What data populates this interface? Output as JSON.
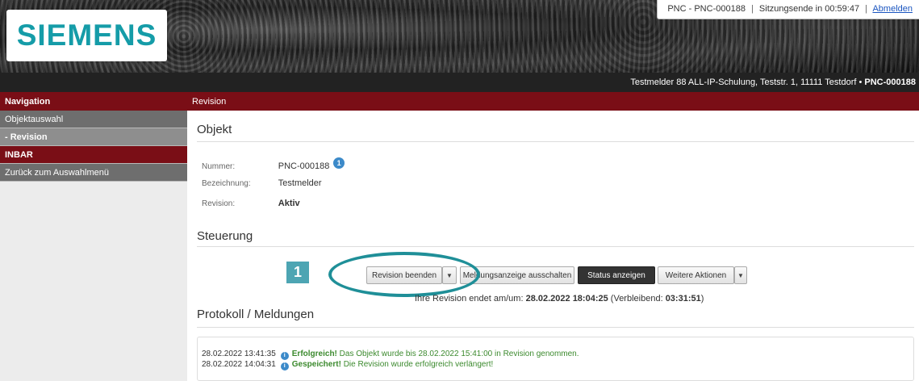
{
  "header": {
    "brand": "SIEMENS",
    "session": {
      "pnc": "PNC - PNC-000188",
      "separator": "|",
      "session_end": "Sitzungsende in 00:59:47",
      "logout": "Abmelden"
    },
    "subheader": {
      "location": "Testmelder 88 ALL-IP-Schulung, Teststr. 1, 11111 Testdorf",
      "bullet": "•",
      "id": "PNC-000188"
    }
  },
  "sidebar": {
    "title": "Navigation",
    "items": [
      {
        "label": "Objektauswahl"
      },
      {
        "label": "- Revision"
      },
      {
        "label": "INBAR"
      },
      {
        "label": "Zurück zum Auswahlmenü"
      }
    ]
  },
  "main": {
    "title": "Revision",
    "objekt": {
      "heading": "Objekt",
      "nummer_label": "Nummer:",
      "nummer_value": "PNC-000188",
      "nummer_badge": "1",
      "bezeichnung_label": "Bezeichnung:",
      "bezeichnung_value": "Testmelder",
      "revision_label": "Revision:",
      "revision_value": "Aktiv"
    },
    "steuerung": {
      "heading": "Steuerung",
      "marker": "1",
      "buttons": {
        "revision_beenden": "Revision beenden",
        "meldungsanzeige": "Meldungsanzeige ausschalten",
        "status_anzeigen": "Status anzeigen",
        "weitere_aktionen": "Weitere Aktionen"
      },
      "info_prefix": "Ihre Revision endet am/um:",
      "info_end": "28.02.2022 18:04:25",
      "info_mid": "(Verbleibend:",
      "info_remaining": "03:31:51",
      "info_suffix": ")"
    },
    "protokoll": {
      "heading": "Protokoll / Meldungen",
      "entries": [
        {
          "time": "28.02.2022 13:41:35",
          "status": "Erfolgreich!",
          "text": "Das Objekt wurde bis 28.02.2022 15:41:00 in Revision genommen."
        },
        {
          "time": "28.02.2022 14:04:31",
          "status": "Gespeichert!",
          "text": "Die Revision wurde erfolgreich verlängert!"
        }
      ]
    }
  },
  "colors": {
    "brand_teal": "#159ca8",
    "nav_red": "#7a0e16",
    "success_green": "#3c8a2e",
    "info_blue": "#3c8ac9",
    "highlight_teal": "#1f8f98"
  },
  "icons": [
    "info-icon",
    "dropdown-caret-icon"
  ]
}
